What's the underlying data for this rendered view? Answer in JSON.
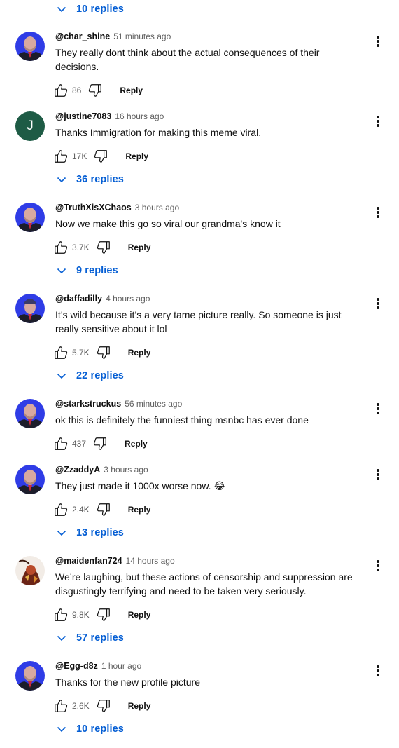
{
  "top_toggle": {
    "label": "10 replies"
  },
  "reply_label": "Reply",
  "comments": [
    {
      "author": "@char_shine",
      "time": "51 minutes ago",
      "text": "They really dont think about the actual consequences of their decisions.",
      "likes": "86",
      "replies": "",
      "avatar": "person"
    },
    {
      "author": "@justine7083",
      "time": "16 hours ago",
      "text": "Thanks Immigration for making this meme viral.",
      "likes": "17K",
      "replies": "36 replies",
      "avatar": "letter",
      "avatar_letter": "J",
      "avatar_color": "#1e5b45"
    },
    {
      "author": "@TruthXisXChaos",
      "time": "3 hours ago",
      "text": "Now we make this go so viral our grandma's know it",
      "likes": "3.7K",
      "replies": "9 replies",
      "avatar": "person"
    },
    {
      "author": "@daffadilly",
      "time": "4 hours ago",
      "text": "It’s wild because it’s a very tame picture really. So someone is just really sensitive about it lol",
      "likes": "5.7K",
      "replies": "22 replies",
      "avatar": "person"
    },
    {
      "author": "@starkstruckus",
      "time": "56 minutes ago",
      "text": "ok this is definitely the funniest thing msnbc has ever done",
      "likes": "437",
      "replies": "",
      "avatar": "person"
    },
    {
      "author": "@ZzaddyA",
      "time": "3 hours ago",
      "text": "They just made it 1000x worse now. 😂",
      "likes": "2.4K",
      "replies": "13 replies",
      "avatar": "person"
    },
    {
      "author": "@maidenfan724",
      "time": "14 hours ago",
      "text": "We’re laughing, but these actions of censorship and suppression are disgustingly terrifying and need to be taken very seriously.",
      "likes": "9.8K",
      "replies": "57 replies",
      "avatar": "photo"
    },
    {
      "author": "@Egg-d8z",
      "time": "1 hour ago",
      "text": "Thanks for the new profile picture",
      "likes": "2.6K",
      "replies": "10 replies",
      "avatar": "person"
    }
  ],
  "colors": {
    "link_blue": "#065fd4",
    "secondary_text": "#606060",
    "avatar_bg_blue": "#2f3ce6"
  },
  "icons": {
    "like": "thumbs-up-icon",
    "dislike": "thumbs-down-icon",
    "more": "more-vert-icon",
    "expand": "chevron-down-icon"
  }
}
